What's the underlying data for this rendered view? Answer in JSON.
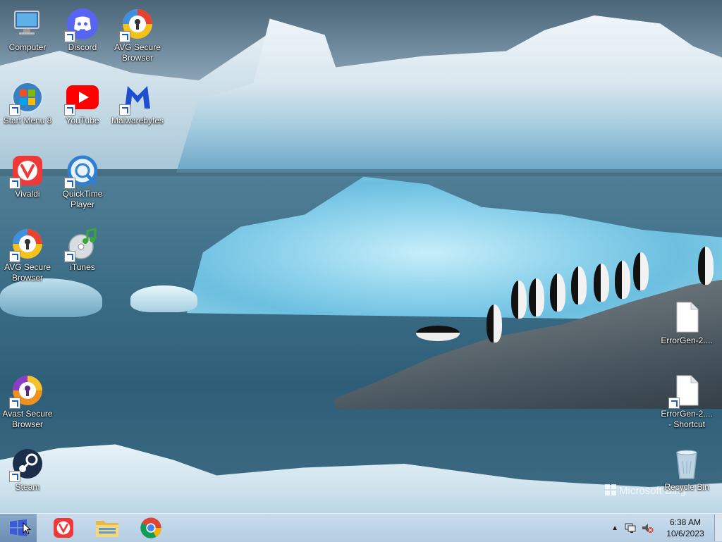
{
  "wallpaper": {
    "watermark": "Microsoft Bing"
  },
  "desktop_icons": [
    {
      "label": "Computer",
      "icon": "computer-icon"
    },
    {
      "label": "Discord",
      "icon": "discord-icon"
    },
    {
      "label": "AVG Secure Browser",
      "icon": "avg-browser-icon"
    },
    {
      "label": "Start Menu 8",
      "icon": "start-menu-8-icon"
    },
    {
      "label": "YouTube",
      "icon": "youtube-icon"
    },
    {
      "label": "Malwarebytes",
      "icon": "malwarebytes-icon"
    },
    {
      "label": "Vivaldi",
      "icon": "vivaldi-icon"
    },
    {
      "label": "QuickTime Player",
      "icon": "quicktime-icon"
    },
    {
      "label": "AVG Secure Browser",
      "icon": "avg-browser-icon"
    },
    {
      "label": "iTunes",
      "icon": "itunes-icon"
    },
    {
      "label": "Avast Secure Browser",
      "icon": "avast-browser-icon"
    },
    {
      "label": "Steam",
      "icon": "steam-icon"
    },
    {
      "label": "ErrorGen-2....",
      "icon": "file-icon"
    },
    {
      "label": "ErrorGen-2.... - Shortcut",
      "icon": "file-shortcut-icon"
    },
    {
      "label": "Recycle Bin",
      "icon": "recycle-bin-icon"
    }
  ],
  "taskbar": {
    "pinned": [
      {
        "name": "vivaldi",
        "icon": "vivaldi-icon"
      },
      {
        "name": "file-explorer",
        "icon": "folder-icon"
      },
      {
        "name": "chrome",
        "icon": "chrome-icon"
      }
    ],
    "clock": {
      "time": "6:38 AM",
      "date": "10/6/2023"
    }
  }
}
